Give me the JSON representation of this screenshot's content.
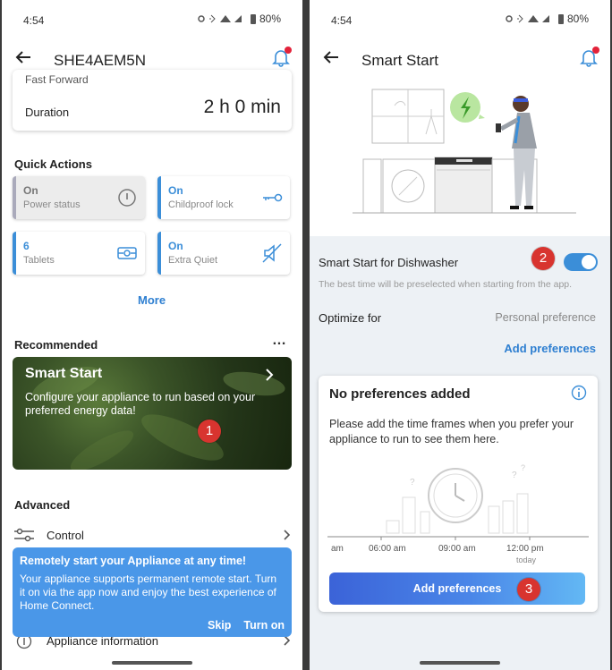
{
  "left": {
    "status": {
      "time": "4:54",
      "battery": "80%"
    },
    "appbar": {
      "title": "SHE4AEM5N"
    },
    "program": {
      "partial_label": "Fast Forward",
      "duration_label": "Duration",
      "duration_value": "2 h 0 min"
    },
    "quick_actions": {
      "heading": "Quick Actions",
      "items": [
        {
          "value": "On",
          "label": "Power status",
          "icon": "power-info-icon"
        },
        {
          "value": "On",
          "label": "Childproof lock",
          "icon": "key-icon"
        },
        {
          "value": "6",
          "label": "Tablets",
          "icon": "tablet-icon"
        },
        {
          "value": "On",
          "label": "Extra Quiet",
          "icon": "mute-icon"
        }
      ],
      "more_label": "More"
    },
    "recommended": {
      "heading": "Recommended",
      "menu_glyph": "…",
      "card_title": "Smart Start",
      "card_text": "Configure your appliance to run based on your preferred energy data!",
      "badge": "1"
    },
    "advanced": {
      "heading": "Advanced",
      "control_label": "Control",
      "appliance_info_label": "Appliance information"
    },
    "toast": {
      "title": "Remotely start your Appliance at any time!",
      "body": "Your appliance supports permanent remote start. Turn it on via the app now and enjoy the best experience of Home Connect.",
      "skip": "Skip",
      "turn_on": "Turn on"
    }
  },
  "right": {
    "status": {
      "time": "4:54",
      "battery": "80%"
    },
    "appbar": {
      "title": "Smart Start"
    },
    "smart_start": {
      "label": "Smart Start for Dishwasher",
      "enabled": true,
      "badge": "2",
      "hint": "The best time will be preselected when starting from the app."
    },
    "optimize": {
      "label": "Optimize for",
      "value": "Personal preference"
    },
    "add_prefs_link": "Add preferences",
    "empty_card": {
      "title": "No preferences added",
      "text": "Please add the time frames when you prefer your appliance to run to see them here.",
      "timeline": [
        "am",
        "06:00 am",
        "09:00 am",
        "12:00 pm"
      ],
      "today": "today"
    },
    "add_button": {
      "label": "Add preferences",
      "badge": "3"
    }
  },
  "colors": {
    "accent": "#2e7fd1",
    "toggle": "#3b8ed8",
    "badge": "#d8342f",
    "toast": "#4a97e8"
  }
}
